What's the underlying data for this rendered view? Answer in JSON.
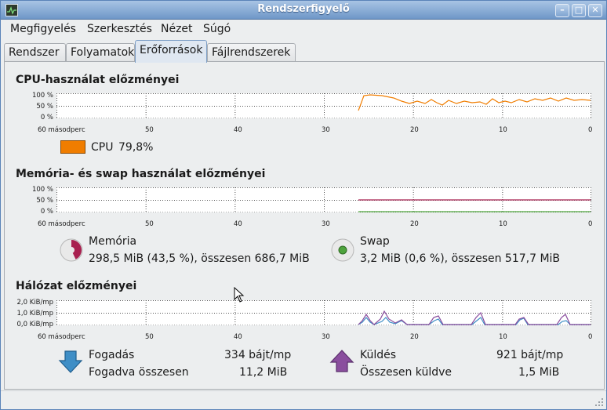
{
  "window": {
    "title": "Rendszerfigyelő",
    "minimize": "–",
    "maximize": "□",
    "close": "✕"
  },
  "menu": [
    "Megfigyelés",
    "Szerkesztés",
    "Nézet",
    "Súgó"
  ],
  "tabs": [
    "Rendszer",
    "Folyamatok",
    "Erőforrások",
    "Fájlrendszerek"
  ],
  "active_tab": "Erőforrások",
  "x_axis": [
    "60 másodperc",
    "50",
    "40",
    "30",
    "20",
    "10",
    "0"
  ],
  "cpu": {
    "title": "CPU-használat előzményei",
    "y_axis": [
      "100 %",
      "50 %",
      "0 %"
    ],
    "legend_label": "CPU",
    "legend_value": "79,8%",
    "color": "#f07d00"
  },
  "memory": {
    "title": "Memória- és swap használat előzményei",
    "y_axis": [
      "100 %",
      "50 %",
      "0 %"
    ],
    "mem_label": "Memória",
    "mem_value": "298,5 MiB (43,5 %), összesen 686,7 MiB",
    "mem_color": "#a8204f",
    "swap_label": "Swap",
    "swap_value": "3,2 MiB (0,6 %), összesen 517,7 MiB",
    "swap_color": "#4ea33c"
  },
  "network": {
    "title": "Hálózat előzményei",
    "y_axis": [
      "2,0 KiB/mp",
      "1,0 KiB/mp",
      "0,0 KiB/mp"
    ],
    "recv_label": "Fogadás",
    "recv_rate": "334 bájt/mp",
    "recv_total_label": "Fogadva összesen",
    "recv_total": "11,2 MiB",
    "send_label": "Küldés",
    "send_rate": "921 bájt/mp",
    "send_total_label": "Összesen küldve",
    "send_total": "1,5 MiB",
    "recv_color": "#3e8ec6",
    "send_color": "#8a4e9e"
  }
}
